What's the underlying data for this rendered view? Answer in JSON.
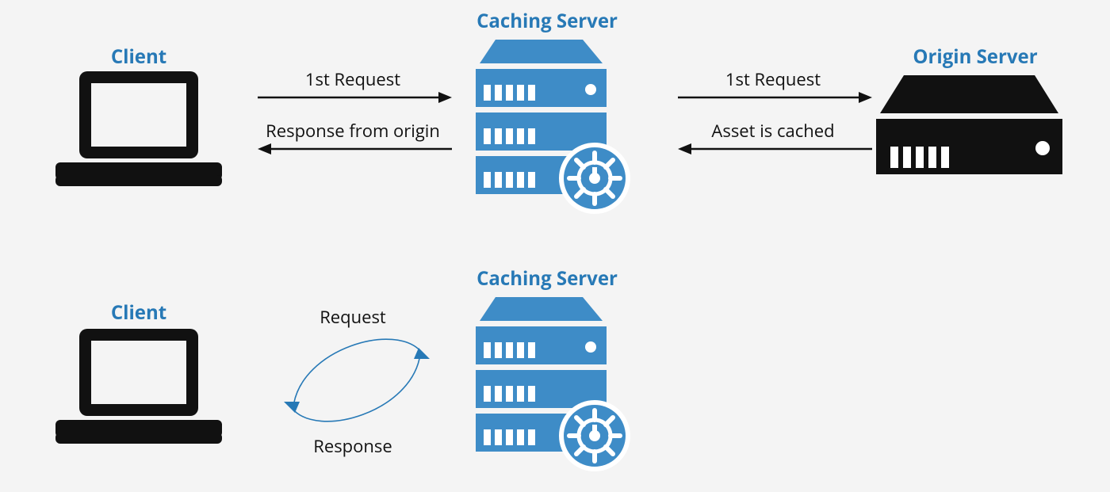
{
  "colors": {
    "accent": "#2779b6",
    "accent_fill": "#3e8cc7",
    "black": "#111111"
  },
  "top": {
    "client_title": "Client",
    "caching_title": "Caching Server",
    "origin_title": "Origin Server",
    "req_left": "1st Request",
    "resp_left": "Response from origin",
    "req_right": "1st Request",
    "resp_right": "Asset is cached"
  },
  "bottom": {
    "client_title": "Client",
    "caching_title": "Caching Server",
    "req": "Request",
    "resp": "Response"
  }
}
